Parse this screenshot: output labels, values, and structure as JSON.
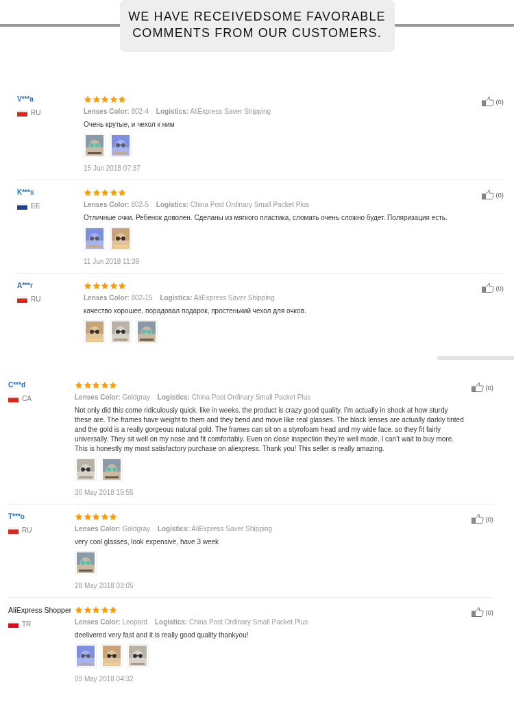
{
  "header": {
    "title_lines": [
      "WE HAVE RECEIVEDSOME FAVORABLE",
      "COMMENTS FROM OUR CUSTOMERS."
    ]
  },
  "groups": [
    {
      "reviews": [
        {
          "author": "V***a",
          "masked": true,
          "color": "#d52b1e",
          "country": "RU",
          "stars": 5,
          "lenses_label": "Lenses Color:",
          "lenses": "802-4",
          "logistics_label": "Logistics:",
          "logistics": "AliExpress Saver Shipping",
          "text": "Очень крутые, и чехол к ним",
          "photos": [
            {
              "kind": "picture"
            },
            {
              "kind": "picture"
            }
          ],
          "date": "15 Jun 2018 07:37",
          "likes": "(0)"
        },
        {
          "author": "K***s",
          "masked": true,
          "color": "#1f3f8f",
          "country": "EE",
          "stars": 5,
          "lenses_label": "Lenses Color:",
          "lenses": "802-5",
          "logistics_label": "Logistics:",
          "logistics": "China Post Ordinary Small Packet Plus",
          "text": "Отличные очки. Ребенок доволен. Сделаны из мягкого пластика, сломать очень сложно будет. Поляризация есть.",
          "photos": [
            {
              "kind": "picture"
            },
            {
              "kind": "picture"
            }
          ],
          "date": "11 Jun 2018 11:39",
          "likes": "(0)"
        },
        {
          "author": "A***r",
          "masked": true,
          "color": "#d52b1e",
          "country": "RU",
          "stars": 5,
          "lenses_label": "Lenses Color:",
          "lenses": "802-15",
          "logistics_label": "Logistics:",
          "logistics": "AliExpress Saver Shipping",
          "text": "качество хорошее, порадовал подарок, простенький чехол для очков.",
          "photos": [
            {
              "kind": "picture"
            },
            {
              "kind": "picture"
            },
            {
              "kind": "picture"
            }
          ],
          "likes": "(0)"
        }
      ]
    },
    {
      "reviews": [
        {
          "author": "C***d",
          "masked": true,
          "color": "#d52b1e",
          "country": "CA",
          "stars": 5,
          "lenses_label": "Lenses Color:",
          "lenses": "Goldgray",
          "logistics_label": "Logistics:",
          "logistics": "China Post Ordinary Small Packet Plus",
          "text": "Not only did this come ridiculously quick. like in weeks. the product is crazy good quality. I’m actually in shock at how sturdy these are. The frames have weight to them and they bend and move like real glasses. The black lenses are actually darkly tinted and the gold is a really gorgeous natural gold. The frames can sit on a styrofoam head and my wide face. so they fit fairly universally. They sit well on my nose and fit comfortably. Even on close inspection they’re well made. I can’t wait to buy more. This is honestly my most satisfactory purchase on aliexpress. Thank you! This seller is really amazing.",
          "photos": [
            {
              "kind": "picture"
            },
            {
              "kind": "picture"
            }
          ],
          "date": "30 May 2018 19:55",
          "likes": "(0)"
        },
        {
          "author": "T***o",
          "masked": true,
          "color": "#d52b1e",
          "country": "RU",
          "stars": 5,
          "lenses_label": "Lenses Color:",
          "lenses": "Goldgray",
          "logistics_label": "Logistics:",
          "logistics": "AliExpress Saver Shipping",
          "text": "very cool glasses, look expensive, have 3 week",
          "photos": [
            {
              "kind": "picture"
            }
          ],
          "date": "28 May 2018 03:05",
          "likes": "(0)"
        },
        {
          "author": "AliExpress Shopper",
          "masked": false,
          "color": "#e30a17",
          "country": "TR",
          "stars": 5,
          "lenses_label": "Lenses Color:",
          "lenses": "Leopard",
          "logistics_label": "Logistics:",
          "logistics": "China Post Ordinary Small Packet Plus",
          "text": "deelivered very fast and it is really good quality thankyou!",
          "photos": [
            {
              "kind": "picture"
            },
            {
              "kind": "picture"
            },
            {
              "kind": "picture"
            }
          ],
          "date": "09 May 2018 04:32",
          "likes": "(0)"
        }
      ]
    }
  ]
}
